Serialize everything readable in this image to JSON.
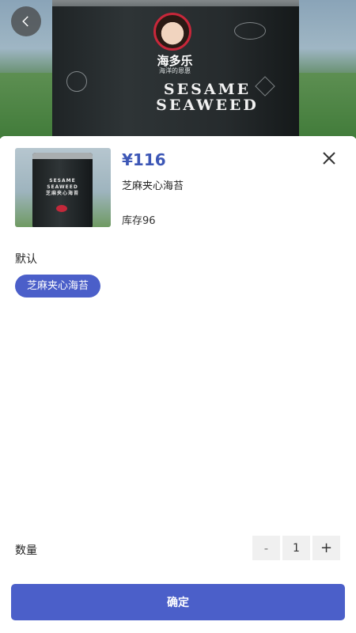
{
  "banner": {
    "brand_logo_text": "海多乐",
    "brand_slogan": "海洋的恩惠",
    "title_line1": "SESAME",
    "title_line2": "SEAWEED"
  },
  "product": {
    "price": "¥116",
    "name": "芝麻夹心海苔",
    "stock": "库存96",
    "thumbnail_label_line1": "SESAME",
    "thumbnail_label_line2": "SEAWEED",
    "thumbnail_label_line3": "芝麻夹心海苔"
  },
  "spec": {
    "group_title": "默认",
    "options": [
      "芝麻夹心海苔"
    ],
    "selected": "芝麻夹心海苔"
  },
  "quantity": {
    "label": "数量",
    "minus": "-",
    "value": "1",
    "plus": "+"
  },
  "confirm_label": "确定",
  "icons": {
    "back": "chevron-left-icon",
    "close": "close-icon"
  },
  "colors": {
    "accent": "#4b5fc9",
    "price": "#3d57b6"
  }
}
